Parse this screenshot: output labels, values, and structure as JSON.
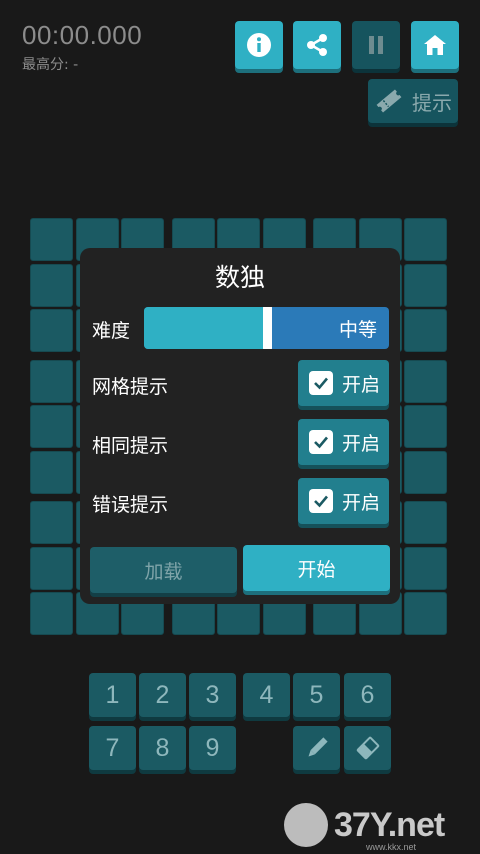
{
  "header": {
    "timer": "00:00.000",
    "best_score": "最高分: -"
  },
  "toolbar": {
    "info_icon": "info-icon",
    "share_icon": "share-icon",
    "pause_icon": "pause-icon",
    "home_icon": "home-icon",
    "hint_label": "提示"
  },
  "dialog": {
    "title": "数独",
    "difficulty_label": "难度",
    "difficulty_value": "中等",
    "difficulty_level": 0.5,
    "grid_hint_label": "网格提示",
    "grid_hint_toggle": "开启",
    "same_hint_label": "相同提示",
    "same_hint_toggle": "开启",
    "error_hint_label": "错误提示",
    "error_hint_toggle": "开启",
    "load_button": "加载",
    "start_button": "开始"
  },
  "numpad": {
    "keys": [
      "1",
      "2",
      "3",
      "4",
      "5",
      "6",
      "7",
      "8",
      "9"
    ],
    "pencil_icon": "pencil-icon",
    "eraser_icon": "eraser-icon"
  },
  "watermark": {
    "brand": "37Y.net",
    "small": "www.kkx.net"
  },
  "colors": {
    "background": "#191919",
    "accent": "#2fb0c4",
    "dark_teal": "#1b5a63",
    "slider_blue": "#2b7ab8"
  }
}
